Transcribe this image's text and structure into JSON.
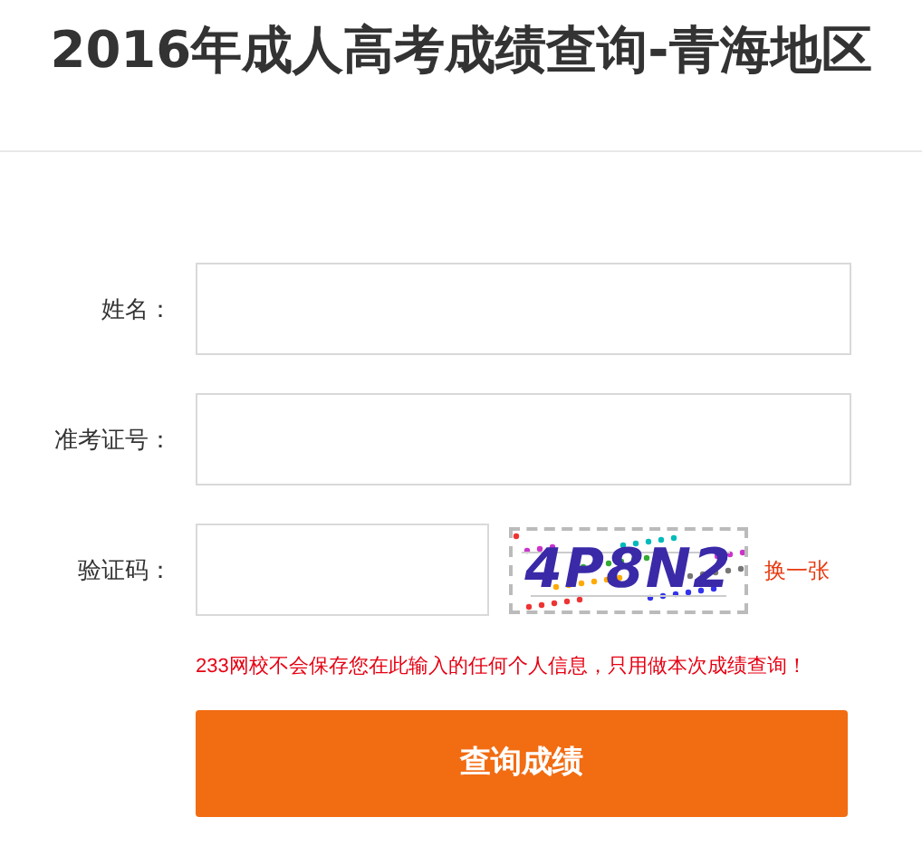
{
  "title": "2016年成人高考成绩查询-青海地区",
  "fields": [
    {
      "label": "姓名："
    },
    {
      "label": "准考证号："
    }
  ],
  "captcha": {
    "label": "验证码：",
    "code": "4P8N2",
    "refresh": "换一张"
  },
  "notice": "233网校不会保存您在此输入的任何个人信息，只用做本次成绩查询！",
  "submit": "查询成绩"
}
